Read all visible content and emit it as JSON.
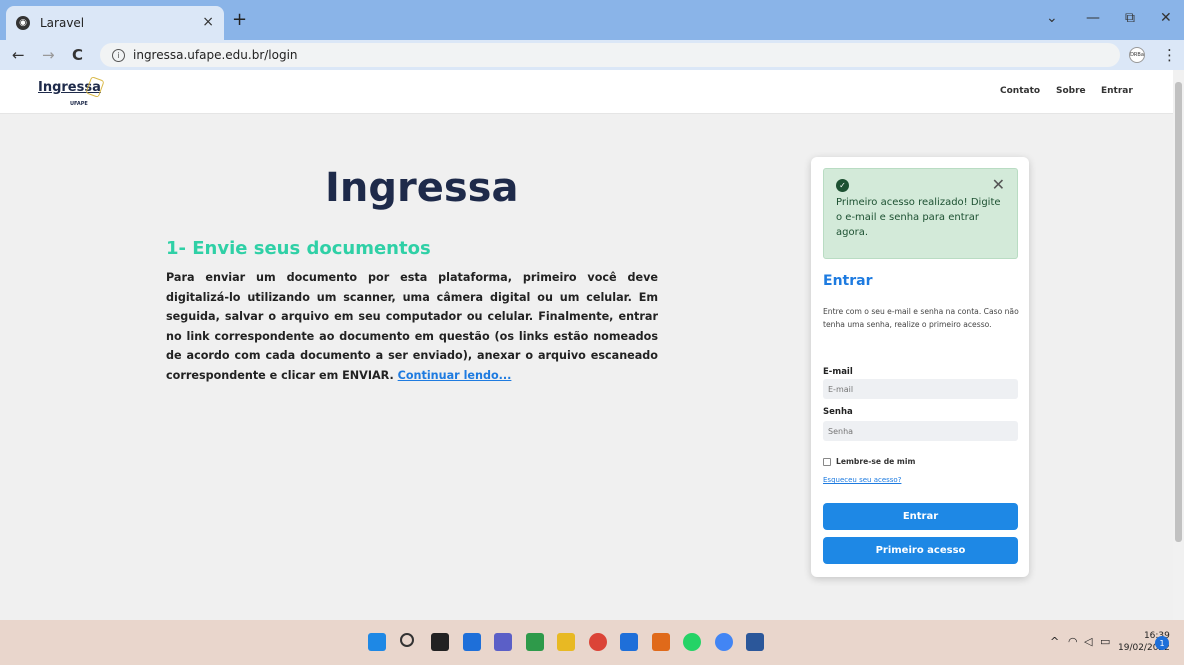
{
  "browser": {
    "tab_title": "Laravel",
    "tab_close": "×",
    "new_tab": "+",
    "url": "ingressa.ufape.edu.br/login",
    "profile_label": "DRBa",
    "back": "←",
    "forward": "→",
    "reload": "C",
    "menu": "⋮",
    "minimize": "—",
    "restore": "⧉",
    "close": "✕",
    "dropdown": "⌄"
  },
  "site": {
    "logo_text": "Ingressa",
    "logo_sub": "UFAPE",
    "nav": {
      "contact": "Contato",
      "about": "Sobre",
      "login": "Entrar"
    },
    "hero_title": "Ingressa",
    "section_title": "1- Envie seus documentos",
    "section_body": "Para enviar um documento por esta plataforma, primeiro você deve digitalizá-lo utilizando um scanner, uma câmera digital ou um celular. Em seguida, salvar o arquivo em seu computador ou celular. Finalmente, entrar no link correspondente ao documento em questão (os links estão nomeados de acordo com cada documento a ser enviado), anexar o arquivo escaneado correspondente e clicar em ENVIAR.",
    "continue_link": "Continuar lendo..."
  },
  "login_card": {
    "alert_text": "Primeiro acesso realizado! Digite o e-mail e senha para entrar agora.",
    "alert_close": "✕",
    "title": "Entrar",
    "description": "Entre com o seu e-mail e senha na conta. Caso não tenha uma senha, realize o primeiro acesso.",
    "email_label": "E-mail",
    "email_placeholder": "E-mail",
    "password_label": "Senha",
    "password_placeholder": "Senha",
    "remember_label": "Lembre-se de mim",
    "forgot_link": "Esqueceu seu acesso?",
    "login_button": "Entrar",
    "first_access_button": "Primeiro acesso"
  },
  "taskbar": {
    "time": "16:39",
    "date": "19/02/2022",
    "notification_count": "1",
    "tray_caret": "^",
    "icons": [
      "windows-start-icon",
      "search-icon",
      "task-view-icon",
      "widgets-icon",
      "chat-icon",
      "pep-app-icon",
      "file-explorer-icon",
      "chrome-icon",
      "notepad-icon",
      "pep-app-icon-2",
      "whatsapp-icon",
      "chrome-profile-icon",
      "word-icon"
    ],
    "icon_colors": [
      "#1e88e5",
      "#333333",
      "#222222",
      "#1e6fd9",
      "#5b5fc7",
      "#2e9a4a",
      "#e8b923",
      "#db4437",
      "#1e6fd9",
      "#e06a1a",
      "#25d366",
      "#4285f4",
      "#2b579a"
    ]
  },
  "colors": {
    "accent": "#1e88e5",
    "heading": "#1e2a4a",
    "teal": "#2fd0a6",
    "alert_bg": "#d3ead9"
  }
}
